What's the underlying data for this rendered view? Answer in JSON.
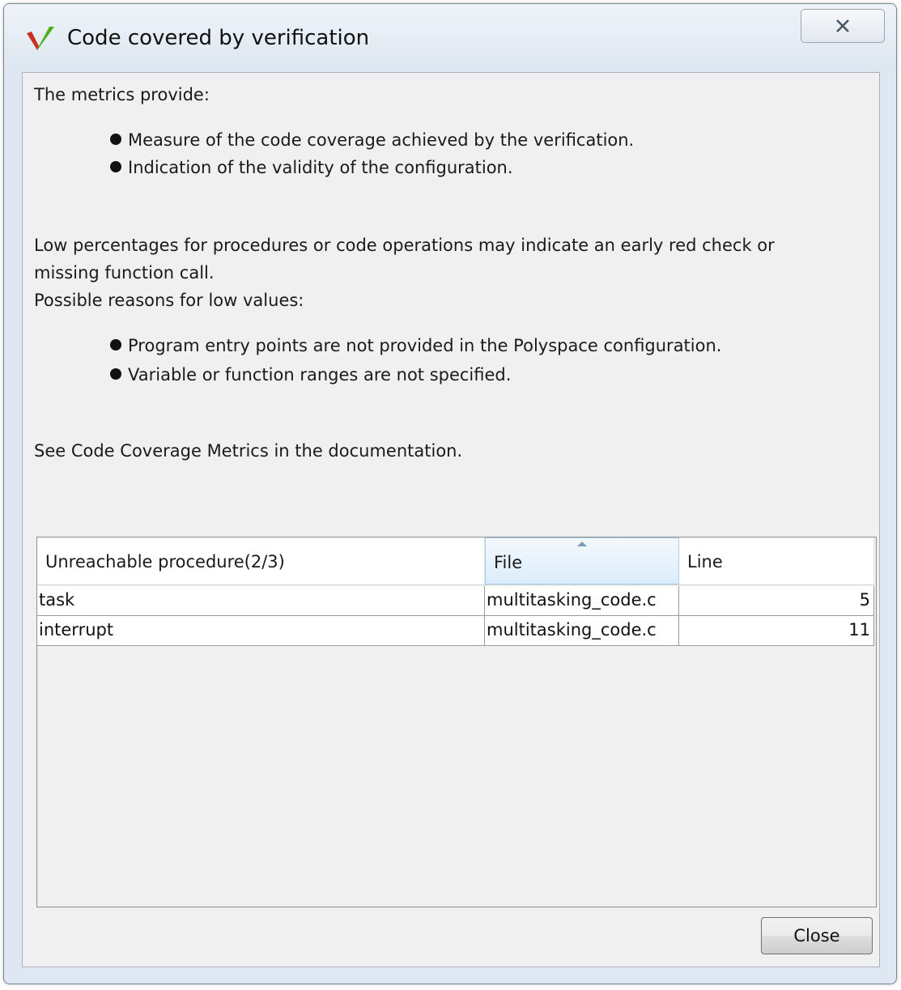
{
  "window": {
    "title": "Code covered by verification",
    "icon": "polyspace-v-icon"
  },
  "message": {
    "intro": "The metrics provide:",
    "provides": [
      "Measure of the code coverage achieved by the verification.",
      "Indication of the validity of the configuration."
    ],
    "low_line1": "Low percentages for procedures or code operations may indicate an early red check or",
    "low_line2": "missing function call.",
    "reasons_intro": "Possible reasons for low values:",
    "reasons": [
      "Program entry points are not provided in the Polyspace configuration.",
      "Variable or function ranges are not specified."
    ],
    "see_also": "See Code Coverage Metrics in the documentation."
  },
  "table": {
    "columns": [
      "Unreachable procedure(2/3)",
      "File",
      "Line"
    ],
    "sorted_column": "File",
    "rows": [
      {
        "procedure": "task",
        "file": "multitasking_code.c",
        "line": "5"
      },
      {
        "procedure": "interrupt",
        "file": "multitasking_code.c",
        "line": "11"
      }
    ]
  },
  "buttons": {
    "close_label": "Close"
  },
  "colors": {
    "title_bar": "#dfe8f2",
    "client_bg": "#f0f0f0",
    "sort_header": "#dcecfb",
    "icon_green": "#4caf1a",
    "icon_red": "#c8321e"
  }
}
